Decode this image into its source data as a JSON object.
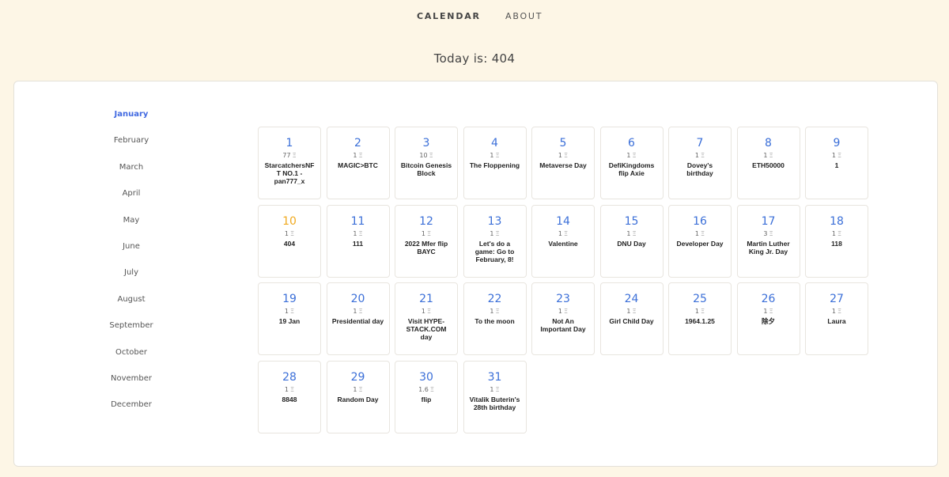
{
  "nav": {
    "calendar": "CALENDAR",
    "about": "ABOUT"
  },
  "today_text": "Today is: 404",
  "months": [
    "January",
    "February",
    "March",
    "April",
    "May",
    "June",
    "July",
    "August",
    "September",
    "October",
    "November",
    "December"
  ],
  "selected_month": "January",
  "currency_symbol": "Ξ",
  "days": [
    {
      "day": "1",
      "price": "77",
      "name": "StarcatchersNFT NO.1 - pan777_x"
    },
    {
      "day": "2",
      "price": "1",
      "name": "MAGIC>BTC"
    },
    {
      "day": "3",
      "price": "10",
      "name": "Bitcoin Genesis Block"
    },
    {
      "day": "4",
      "price": "1",
      "name": "The Floppening"
    },
    {
      "day": "5",
      "price": "1",
      "name": "Metaverse Day"
    },
    {
      "day": "6",
      "price": "1",
      "name": "DefiKingdoms flip Axie"
    },
    {
      "day": "7",
      "price": "1",
      "name": "Dovey's birthday"
    },
    {
      "day": "8",
      "price": "1",
      "name": "ETH50000"
    },
    {
      "day": "9",
      "price": "1",
      "name": "1"
    },
    {
      "day": "10",
      "price": "1",
      "name": "404",
      "today": true
    },
    {
      "day": "11",
      "price": "1",
      "name": "111"
    },
    {
      "day": "12",
      "price": "1",
      "name": "2022 Mfer flip BAYC"
    },
    {
      "day": "13",
      "price": "1",
      "name": "Let's do a game: Go to February, 8!"
    },
    {
      "day": "14",
      "price": "1",
      "name": "Valentine"
    },
    {
      "day": "15",
      "price": "1",
      "name": "DNU Day"
    },
    {
      "day": "16",
      "price": "1",
      "name": "Developer Day"
    },
    {
      "day": "17",
      "price": "3",
      "name": "Martin Luther King Jr. Day"
    },
    {
      "day": "18",
      "price": "1",
      "name": "118"
    },
    {
      "day": "19",
      "price": "1",
      "name": "19 Jan"
    },
    {
      "day": "20",
      "price": "1",
      "name": "Presidential day"
    },
    {
      "day": "21",
      "price": "1",
      "name": "Visit HYPE-STACK.COM day"
    },
    {
      "day": "22",
      "price": "1",
      "name": "To the moon"
    },
    {
      "day": "23",
      "price": "1",
      "name": "Not An Important Day"
    },
    {
      "day": "24",
      "price": "1",
      "name": "Girl Child Day"
    },
    {
      "day": "25",
      "price": "1",
      "name": "1964.1.25"
    },
    {
      "day": "26",
      "price": "1",
      "name": "除夕"
    },
    {
      "day": "27",
      "price": "1",
      "name": "Laura"
    },
    {
      "day": "28",
      "price": "1",
      "name": "8848"
    },
    {
      "day": "29",
      "price": "1",
      "name": "Random Day"
    },
    {
      "day": "30",
      "price": "1.6",
      "name": "flip"
    },
    {
      "day": "31",
      "price": "1",
      "name": "Vitalik Buterin's 28th birthday"
    }
  ],
  "colors": {
    "accent": "#3b6fd8",
    "today": "#f0a91e",
    "background": "#fdf6e6"
  }
}
